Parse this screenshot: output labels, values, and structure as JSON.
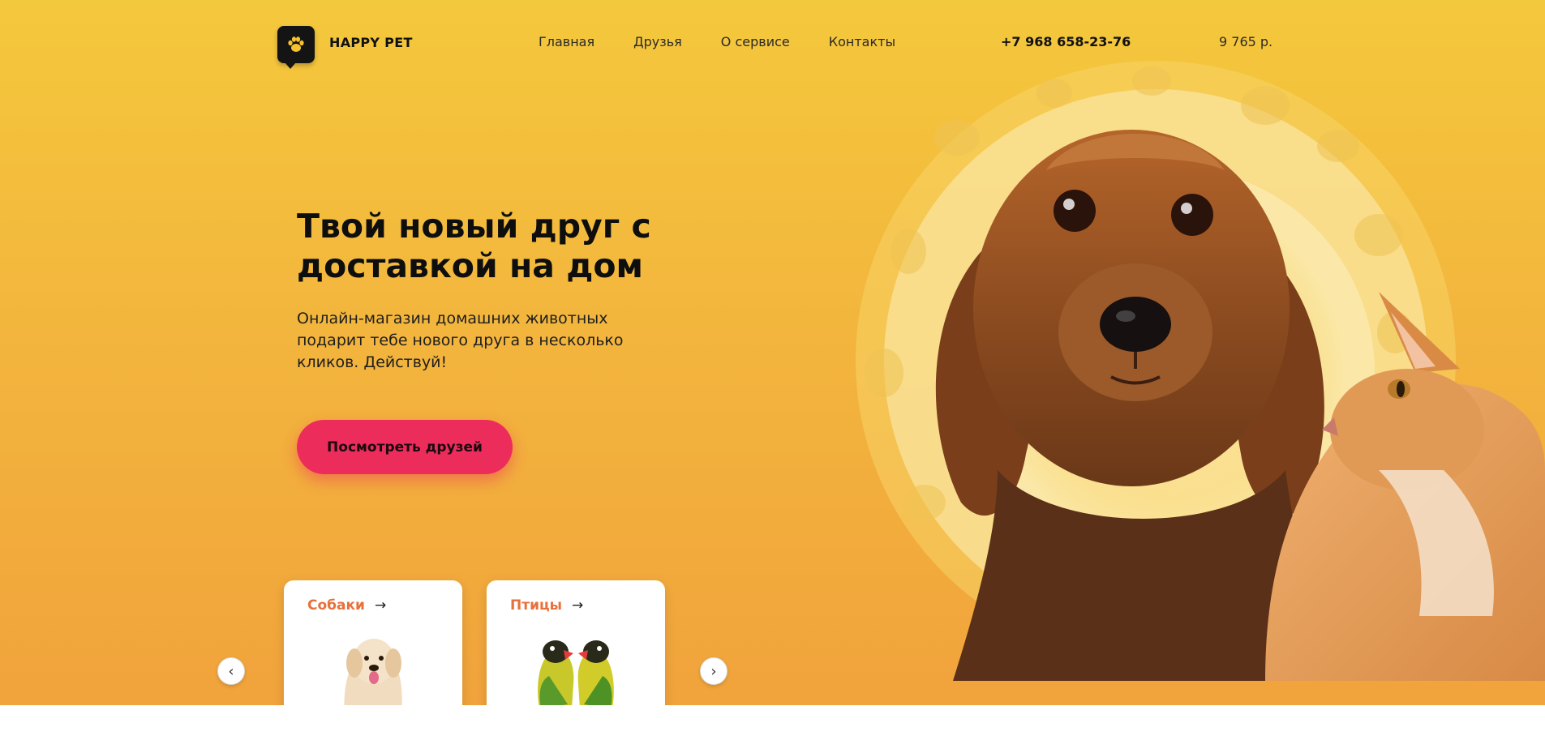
{
  "brand": {
    "name": "HAPPY PET",
    "logo_icon": "paw-icon"
  },
  "nav": {
    "items": [
      {
        "label": "Главная"
      },
      {
        "label": "Друзья"
      },
      {
        "label": "О сервисе"
      },
      {
        "label": "Контакты"
      }
    ]
  },
  "header": {
    "phone": "+7 968 658-23-76",
    "cart_total": "9 765 р."
  },
  "hero": {
    "title_line1": "Твой новый друг с",
    "title_line2": "доставкой на дом",
    "subtitle": "Онлайн-магазин домашних животных подарит тебе нового друга в несколько кликов. Действуй!",
    "cta_label": "Посмотреть друзей"
  },
  "categories": [
    {
      "label": "Собаки",
      "arrow": "→",
      "image": "dog-photo"
    },
    {
      "label": "Птицы",
      "arrow": "→",
      "image": "parrots-photo"
    }
  ],
  "slider": {
    "prev_icon": "chevron-left-icon",
    "next_icon": "chevron-right-icon"
  },
  "colors": {
    "accent": "#ec2d5b",
    "category_label": "#e8703a",
    "hero_bg_top": "#f4c83c",
    "hero_bg_bottom": "#f1a33c"
  }
}
